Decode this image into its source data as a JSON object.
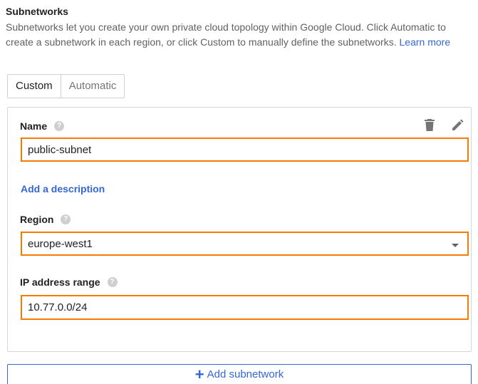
{
  "section": {
    "title": "Subnetworks",
    "description": "Subnetworks let you create your own private cloud topology within Google Cloud. Click Automatic to create a subnetwork in each region, or click Custom to manually define the subnetworks.",
    "learn_more": "Learn more"
  },
  "tabs": [
    {
      "label": "Custom",
      "active": true
    },
    {
      "label": "Automatic",
      "active": false
    }
  ],
  "subnet_form": {
    "name_label": "Name",
    "name_value": "public-subnet",
    "add_description": "Add a description",
    "region_label": "Region",
    "region_value": "europe-west1",
    "ip_label": "IP address range",
    "ip_value": "10.77.0.0/24",
    "help_glyph": "?"
  },
  "icons": {
    "delete": "trash-icon",
    "edit": "pencil-icon",
    "help": "help-icon",
    "dropdown": "chevron-down-icon",
    "add": "plus-icon"
  },
  "add_button": {
    "plus": "+",
    "label": "Add subnetwork"
  },
  "colors": {
    "highlight": "#f57c00",
    "link": "#3367d6"
  }
}
